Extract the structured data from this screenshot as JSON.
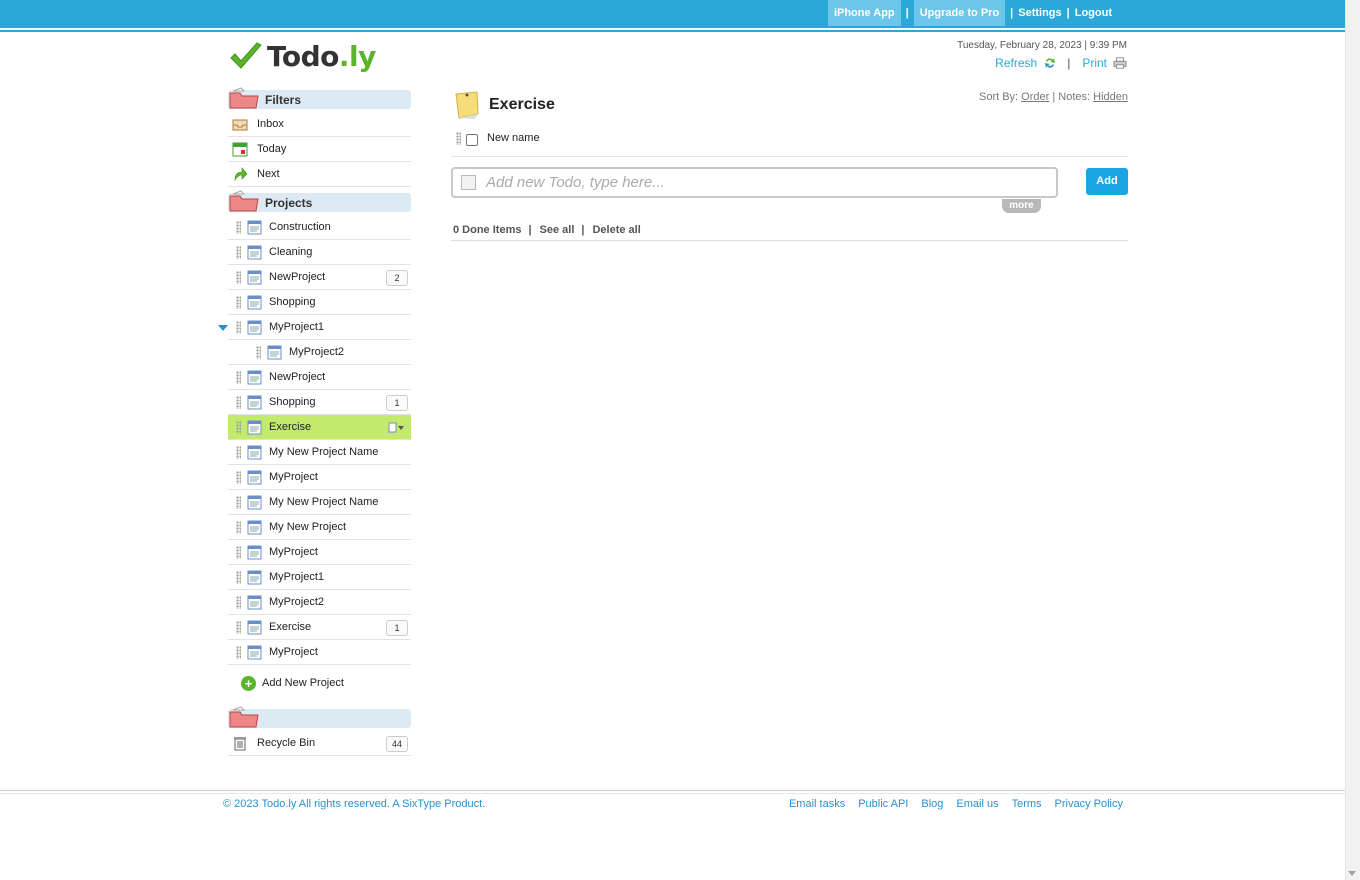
{
  "topbar": {
    "iphone_app": "iPhone App",
    "upgrade": "Upgrade to Pro",
    "settings": "Settings",
    "logout": "Logout",
    "sep": "|"
  },
  "header": {
    "logo_text_main": "Todo",
    "logo_text_dot": ".ly",
    "datetime": "Tuesday, February 28, 2023 | 9:39 PM",
    "refresh": "Refresh",
    "print": "Print",
    "sep": "|"
  },
  "sidebar": {
    "filters_title": "Filters",
    "filters": [
      {
        "label": "Inbox",
        "icon": "inbox-icon"
      },
      {
        "label": "Today",
        "icon": "calendar-icon"
      },
      {
        "label": "Next",
        "icon": "next-arrow-icon"
      }
    ],
    "projects_title": "Projects",
    "projects": [
      {
        "label": "Construction",
        "count": ""
      },
      {
        "label": "Cleaning",
        "count": ""
      },
      {
        "label": "NewProject",
        "count": "2"
      },
      {
        "label": "Shopping",
        "count": ""
      },
      {
        "label": "MyProject1",
        "count": "",
        "expanded": true
      },
      {
        "label": "MyProject2",
        "count": "",
        "sub": true
      },
      {
        "label": "NewProject",
        "count": ""
      },
      {
        "label": "Shopping",
        "count": "1"
      },
      {
        "label": "Exercise",
        "count": "",
        "active": true
      },
      {
        "label": "My New Project Name",
        "count": ""
      },
      {
        "label": "MyProject",
        "count": ""
      },
      {
        "label": "My New Project Name",
        "count": ""
      },
      {
        "label": "My New Project",
        "count": ""
      },
      {
        "label": "MyProject",
        "count": ""
      },
      {
        "label": "MyProject1",
        "count": ""
      },
      {
        "label": "MyProject2",
        "count": ""
      },
      {
        "label": "Exercise",
        "count": "1"
      },
      {
        "label": "MyProject",
        "count": ""
      }
    ],
    "add_project": "Add New Project",
    "recycle_bin": "Recycle Bin",
    "recycle_count": "44"
  },
  "main": {
    "project_title": "Exercise",
    "sort_by_label": "Sort By:",
    "sort_by_value": "Order",
    "notes_label": "| Notes:",
    "notes_value": "Hidden",
    "items": [
      {
        "text": "New name",
        "checked": false
      }
    ],
    "new_todo_placeholder": "Add new Todo, type here...",
    "add_button": "Add",
    "more_button": "more",
    "done_items": "0 Done Items",
    "see_all": "See all",
    "delete_all": "Delete all",
    "sep": "|"
  },
  "footer": {
    "copyright": "© 2023 Todo.ly All rights reserved. A SixType Product.",
    "links": [
      "Email tasks",
      "Public API",
      "Blog",
      "Email us",
      "Terms",
      "Privacy Policy"
    ]
  },
  "colors": {
    "brand_blue": "#2aa8d8",
    "active_green": "#c3ea6c",
    "section_bg": "#dde9f3",
    "add_button": "#1aa6e4"
  }
}
